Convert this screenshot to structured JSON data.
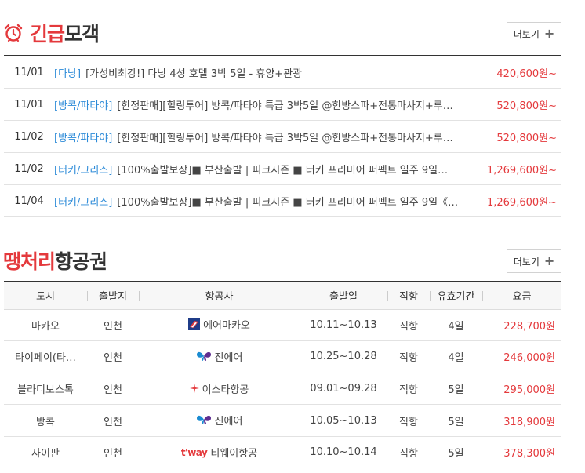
{
  "urgent": {
    "title_accent": "긴급",
    "title_rest": "모객",
    "more_label": "더보기",
    "items": [
      {
        "date": "11/01",
        "category": "[다낭]",
        "title": "[가성비최강!] 다낭 4성 호텔 3박 5일 - 휴양+관광",
        "price": "420,600원~"
      },
      {
        "date": "11/01",
        "category": "[방콕/파타야]",
        "title": "[한정판매][힐링투어] 방콕/파타야 특급 3박5일 @한방스파+전통마사지+루…",
        "price": "520,800원~"
      },
      {
        "date": "11/02",
        "category": "[방콕/파타야]",
        "title": "[한정판매][힐링투어] 방콕/파타야 특급 3박5일 @한방스파+전통마사지+루…",
        "price": "520,800원~"
      },
      {
        "date": "11/02",
        "category": "[터키/그리스]",
        "title": "[100%출발보장]■ 부산출발 | 피크시즌 ■ 터키 프리미어 퍼펙트 일주 9일…",
        "price": "1,269,600원~"
      },
      {
        "date": "11/04",
        "category": "[터키/그리스]",
        "title": "[100%출발보장]■ 부산출발 | 피크시즌 ■ 터키 프리미어 퍼펙트 일주 9일《…",
        "price": "1,269,600원~"
      }
    ]
  },
  "flights": {
    "title_accent": "땡처리",
    "title_rest": "항공권",
    "more_label": "더보기",
    "headers": {
      "city": "도시",
      "origin": "출발지",
      "airline": "항공사",
      "dates": "출발일",
      "direct": "직항",
      "validity": "유효기간",
      "fare": "요금"
    },
    "rows": [
      {
        "city": "마카오",
        "origin": "인천",
        "airline": "에어마카오",
        "logo": "air-macau",
        "dates": "10.11~10.13",
        "direct": "직항",
        "validity": "4일",
        "fare": "228,700원"
      },
      {
        "city": "타이페이(타…",
        "origin": "인천",
        "airline": "진에어",
        "logo": "jinair",
        "dates": "10.25~10.28",
        "direct": "직항",
        "validity": "4일",
        "fare": "246,000원"
      },
      {
        "city": "블라디보스톡",
        "origin": "인천",
        "airline": "이스타항공",
        "logo": "eastar",
        "dates": "09.01~09.28",
        "direct": "직항",
        "validity": "5일",
        "fare": "295,000원"
      },
      {
        "city": "방콕",
        "origin": "인천",
        "airline": "진에어",
        "logo": "jinair",
        "dates": "10.05~10.13",
        "direct": "직항",
        "validity": "5일",
        "fare": "318,900원"
      },
      {
        "city": "사이판",
        "origin": "인천",
        "airline": "티웨이항공",
        "logo": "tway",
        "logo_text": "t'way",
        "dates": "10.10~10.14",
        "direct": "직항",
        "validity": "5일",
        "fare": "378,300원"
      }
    ]
  },
  "colors": {
    "accent": "#e4393c",
    "category": "#2d8bd8",
    "jinair": "#1a8bd1",
    "eastar": "#e4393c"
  }
}
